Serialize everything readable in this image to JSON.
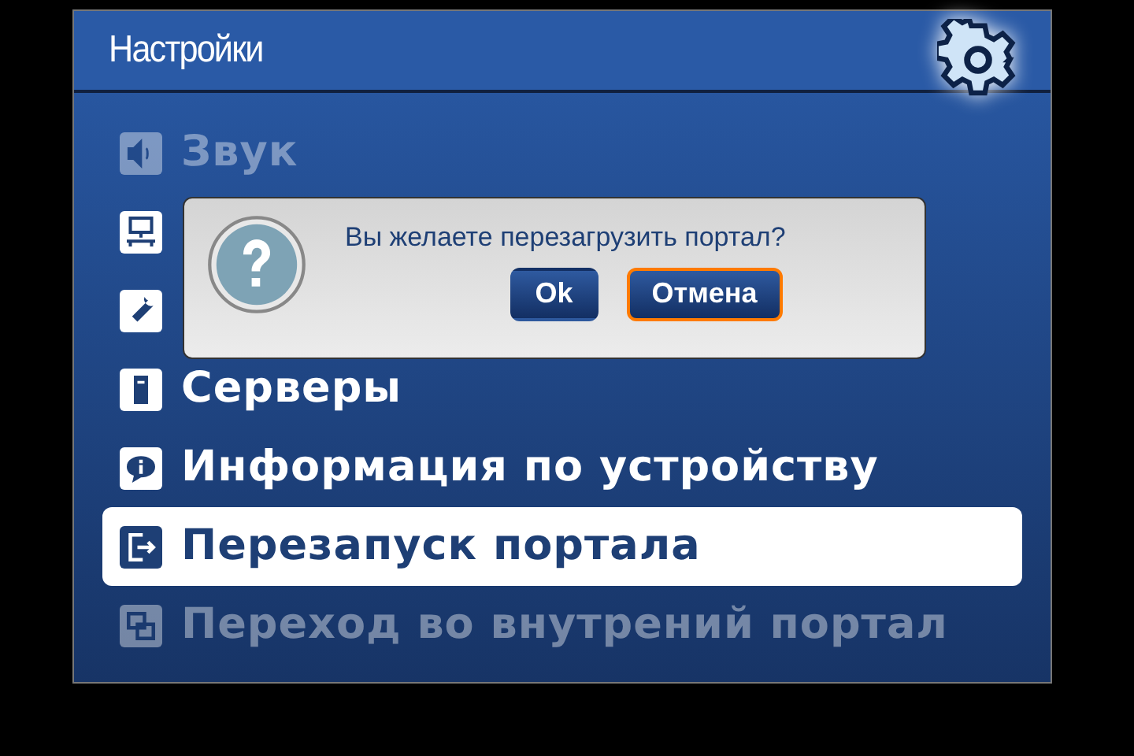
{
  "header": {
    "title": "Настройки"
  },
  "menu": [
    {
      "label": "Звук",
      "selected": false,
      "dimmed": true
    },
    {
      "selected": false,
      "dimmed": false
    },
    {
      "selected": false,
      "dimmed": false
    },
    {
      "label": "Серверы",
      "selected": false,
      "dimmed": false
    },
    {
      "label": "Информация по устройству",
      "selected": false,
      "dimmed": false
    },
    {
      "label": "Перезапуск портала",
      "selected": true,
      "dimmed": false
    },
    {
      "label": "Переход во внутрений портал",
      "selected": false,
      "dimmed": true
    }
  ],
  "dialog": {
    "message": "Вы желаете перезагрузить портал?",
    "buttons": [
      {
        "label": "Ok",
        "selected": false
      },
      {
        "label": "Отмена",
        "selected": true
      }
    ]
  }
}
